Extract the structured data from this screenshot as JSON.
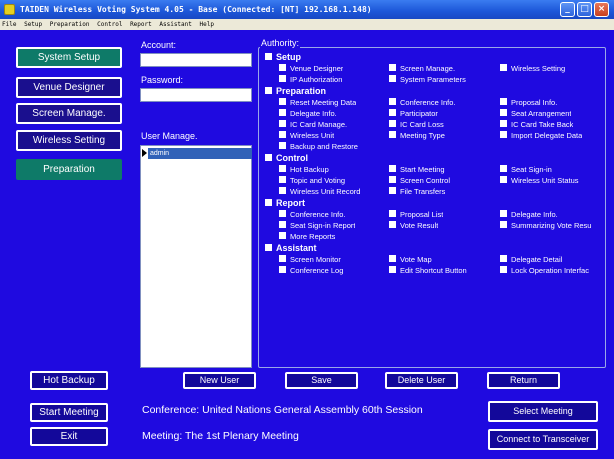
{
  "window": {
    "title": "TAIDEN Wireless Voting System 4.05 - Base (Connected: [NT] 192.168.1.148)",
    "controls": {
      "minimize": "_",
      "maximize": "□",
      "close": "×"
    }
  },
  "menu": [
    "File",
    "Setup",
    "Preparation",
    "Control",
    "Report",
    "Assistant",
    "Help"
  ],
  "nav": {
    "system_setup": "System Setup",
    "venue_designer": "Venue Designer",
    "screen_manage": "Screen Manage.",
    "wireless_setting": "Wireless Setting",
    "preparation": "Preparation"
  },
  "bottom_nav": {
    "hot_backup": "Hot Backup",
    "start_meeting": "Start Meeting",
    "exit": "Exit"
  },
  "form": {
    "account_label": "Account:",
    "account_value": "",
    "password_label": "Password:",
    "password_value": "",
    "user_manage_label": "User Manage.",
    "users": [
      "admin"
    ]
  },
  "authority": {
    "legend": "Authority:",
    "sections": [
      {
        "title": "Setup",
        "rows": [
          [
            "Venue Designer",
            "Screen Manage.",
            "Wireless Setting"
          ],
          [
            "IP Authorization",
            "System Parameters"
          ]
        ]
      },
      {
        "title": "Preparation",
        "rows": [
          [
            "Reset Meeting Data",
            "Conference Info.",
            "Proposal Info."
          ],
          [
            "Delegate Info.",
            "Participator",
            "Seat Arrangement"
          ],
          [
            "IC Card Manage.",
            "IC Card Loss",
            "IC Card Take Back"
          ],
          [
            "Wireless Unit",
            "Meeting Type",
            "Import Delegate Data"
          ],
          [
            "Backup and Restore"
          ]
        ]
      },
      {
        "title": "Control",
        "rows": [
          [
            "Hot Backup",
            "Start Meeting",
            "Seat Sign-in"
          ],
          [
            "Topic and Voting",
            "Screen Control",
            "Wireless Unit Status"
          ],
          [
            "Wireless Unit Record",
            "File Transfers"
          ]
        ]
      },
      {
        "title": "Report",
        "rows": [
          [
            "Conference Info.",
            "Proposal List",
            "Delegate Info."
          ],
          [
            "Seat Sign-in Report",
            "Vote Result",
            "Summarizing Vote Resu"
          ],
          [
            "More Reports"
          ]
        ]
      },
      {
        "title": "Assistant",
        "rows": [
          [
            "Screen Monitor",
            "Vote Map",
            "Delegate Detail"
          ],
          [
            "Conference Log",
            "Edit Shortcut Button",
            "Lock Operation Interfac"
          ]
        ]
      }
    ]
  },
  "actions": {
    "new_user": "New User",
    "save": "Save",
    "delete_user": "Delete User",
    "return": "Return"
  },
  "info": {
    "conference": "Conference: United Nations General Assembly 60th Session",
    "meeting": "Meeting: The 1st Plenary Meeting"
  },
  "right_buttons": {
    "select_meeting": "Select Meeting",
    "connect": "Connect to Transceiver"
  },
  "colors": {
    "background": "#1f0ae0",
    "nav_active": "#0e7a68",
    "button": "#13089a"
  }
}
